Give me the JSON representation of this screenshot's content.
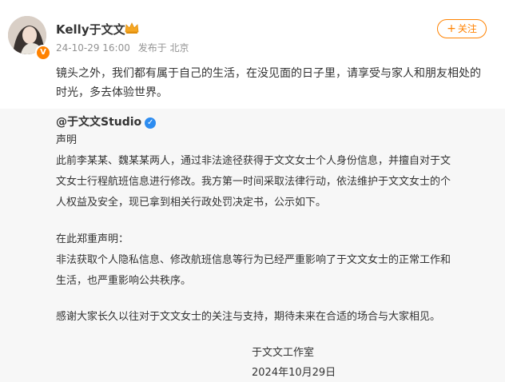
{
  "header": {
    "username": "Kelly于文文",
    "timestamp": "24-10-29 16:00",
    "source": "发布于 北京",
    "follow_label": "关注",
    "follow_plus": "+",
    "avatar_badge": "V",
    "crown_color": "#f5a623"
  },
  "post": {
    "text": "镜头之外，我们都有属于自己的生活，在没见面的日子里，请享受与家人和朋友相处的时光，多去体验世界。"
  },
  "retweet": {
    "author": "@于文文Studio",
    "lines": [
      "声明",
      "此前李某某、魏某某两人，通过非法途径获得于文文女士个人身份信息，并擅自对于文",
      "文女士行程航班信息进行修改。我方第一时间采取法律行动，依法维护于文文女士的个",
      "人权益及安全，现已拿到相关行政处罚决定书，公示如下。",
      "在此郑重声明：",
      "非法获取个人隐私信息、修改航班信息等行为已经严重影响了于文文女士的正常工作和",
      "生活，也严重影响公共秩序。",
      "感谢大家长久以往对于文文女士的关注与支持，期待未来在合适的场合与大家相见。"
    ],
    "signature": "于文文工作室",
    "date": "2024年10月29日"
  },
  "colors": {
    "accent": "#ff8200",
    "meta": "#939393",
    "retweet_bg": "#f7f7f7",
    "verified": "#2d8cf0"
  }
}
